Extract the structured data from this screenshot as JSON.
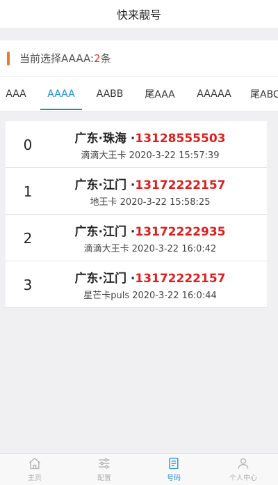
{
  "header": {
    "title": "快来靓号"
  },
  "selection": {
    "prefix": "当前选择AAAA:",
    "count": "2",
    "suffix": "条"
  },
  "tabs": [
    {
      "label": "AAA",
      "active": false
    },
    {
      "label": "AAAA",
      "active": true
    },
    {
      "label": "AABB",
      "active": false
    },
    {
      "label": "尾AAA",
      "active": false
    },
    {
      "label": "AAAAA",
      "active": false
    },
    {
      "label": "尾ABC",
      "active": false
    }
  ],
  "cards": [
    {
      "index": "0",
      "location": "广东·珠海 ·",
      "number": "13128555503",
      "detail": "滴滴大王卡 2020-3-22 15:57:39"
    },
    {
      "index": "1",
      "location": "广东·江门 ·",
      "number": "13172222157",
      "detail": "地王卡 2020-3-22 15:58:25"
    },
    {
      "index": "2",
      "location": "广东·江门 ·",
      "number": "13172222935",
      "detail": "滴滴大王卡 2020-3-22 16:0:42"
    },
    {
      "index": "3",
      "location": "广东·江门 ·",
      "number": "13172222157",
      "detail": "星芒卡puls 2020-3-22 16:0:44"
    }
  ],
  "bottom_nav": [
    {
      "label": "主页",
      "icon": "home-icon",
      "active": false
    },
    {
      "label": "配置",
      "icon": "sliders-icon",
      "active": false
    },
    {
      "label": "号码",
      "icon": "document-icon",
      "active": true
    },
    {
      "label": "个人中心",
      "icon": "user-icon",
      "active": false
    }
  ],
  "colors": {
    "accent": "#1e8ad6",
    "highlight": "#e01e1e",
    "marker": "#e87b2a"
  }
}
